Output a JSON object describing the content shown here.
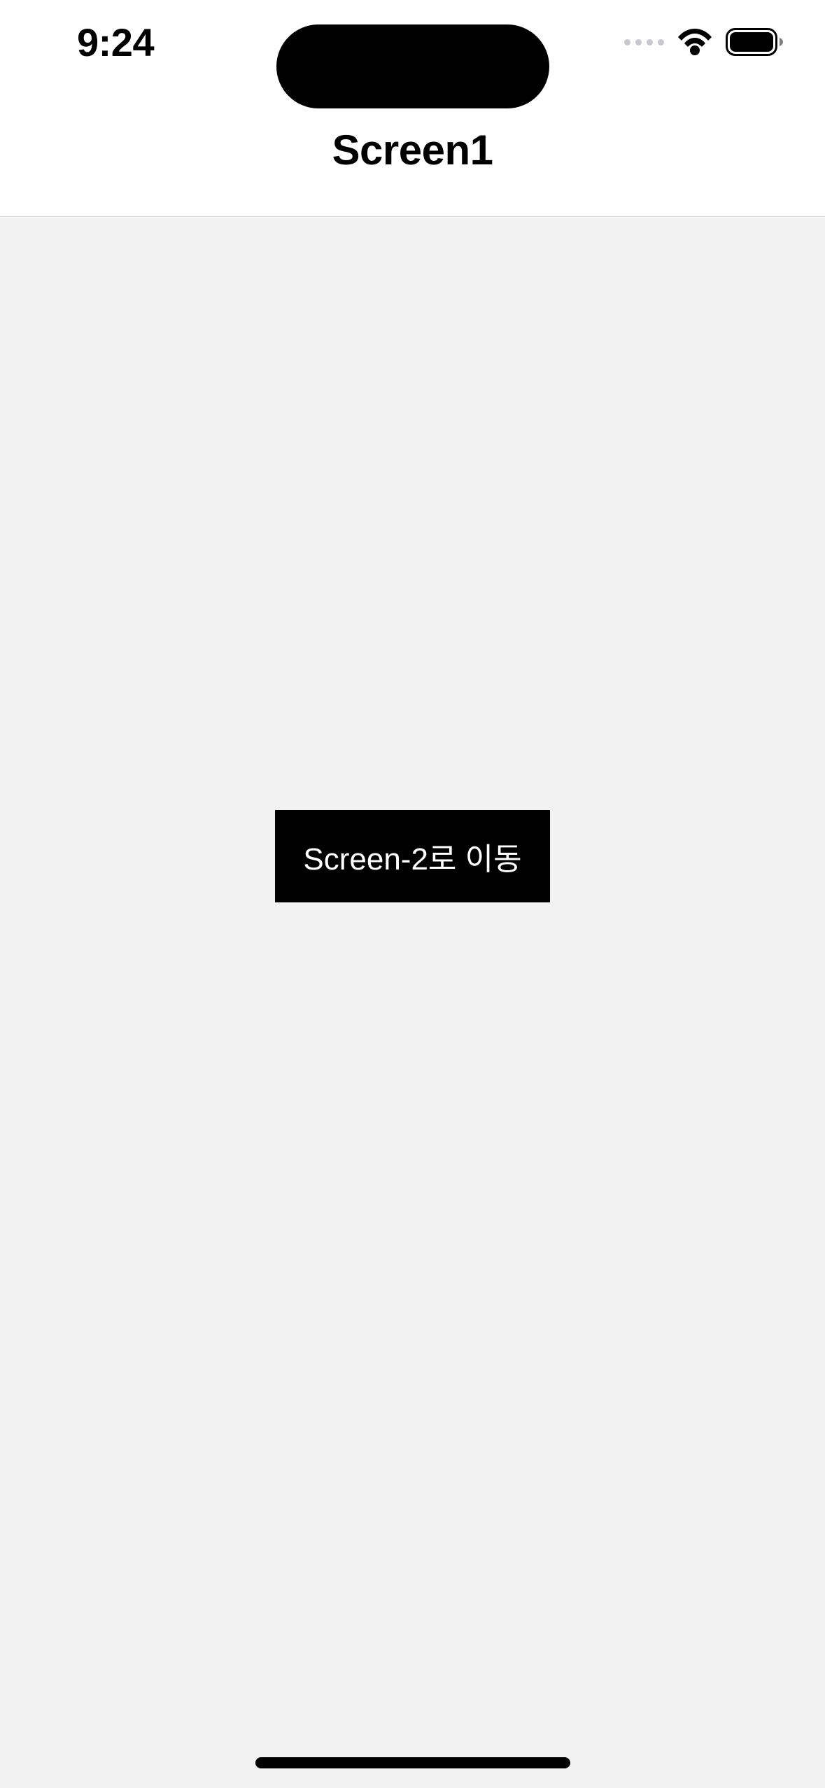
{
  "status_bar": {
    "time": "9:24"
  },
  "nav_bar": {
    "title": "Screen1"
  },
  "content": {
    "button_label": "Screen-2로 이동"
  }
}
